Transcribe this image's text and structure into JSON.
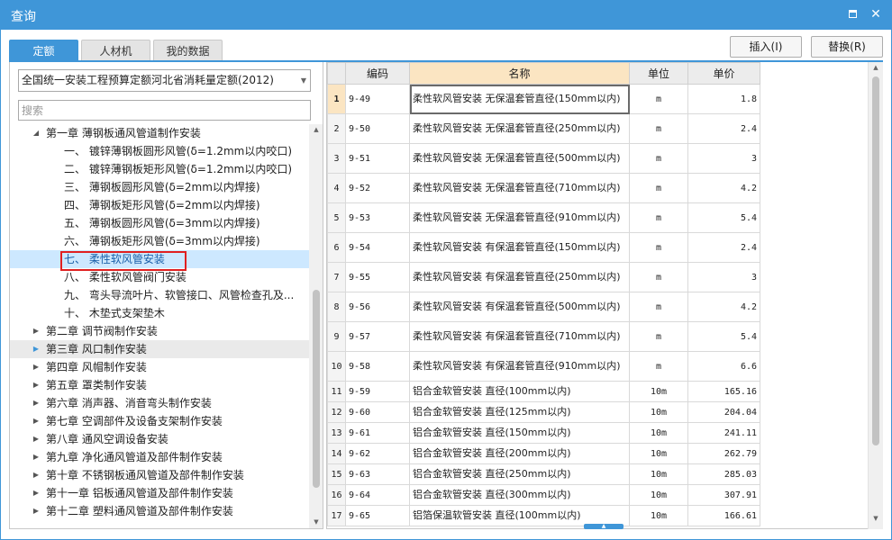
{
  "window": {
    "title": "查询"
  },
  "tabs": [
    {
      "label": "定额",
      "active": true
    },
    {
      "label": "人材机",
      "active": false
    },
    {
      "label": "我的数据",
      "active": false
    }
  ],
  "buttons": {
    "insert": "插入(I)",
    "replace": "替换(R)"
  },
  "left": {
    "combo_value": "全国统一安装工程预算定额河北省消耗量定额(2012)",
    "search_placeholder": "搜索",
    "tree": [
      {
        "label": "第一章 薄钢板通风管道制作安装",
        "level": 0,
        "expanded": true
      },
      {
        "label": "一、 镀锌薄钢板圆形风管(δ=1.2mm以内咬口)",
        "level": 1
      },
      {
        "label": "二、 镀锌薄钢板矩形风管(δ=1.2mm以内咬口)",
        "level": 1
      },
      {
        "label": "三、 薄钢板圆形风管(δ=2mm以内焊接)",
        "level": 1
      },
      {
        "label": "四、 薄钢板矩形风管(δ=2mm以内焊接)",
        "level": 1
      },
      {
        "label": "五、 薄钢板圆形风管(δ=3mm以内焊接)",
        "level": 1
      },
      {
        "label": "六、 薄钢板矩形风管(δ=3mm以内焊接)",
        "level": 1
      },
      {
        "label": "七、 柔性软风管安装",
        "level": 1,
        "selected": true
      },
      {
        "label": "八、 柔性软风管阀门安装",
        "level": 1
      },
      {
        "label": "九、 弯头导流叶片、软管接口、风管检查孔及...",
        "level": 1
      },
      {
        "label": "十、 木垫式支架垫木",
        "level": 1
      },
      {
        "label": "第二章 调节阀制作安装",
        "level": 0
      },
      {
        "label": "第三章 风口制作安装",
        "level": 0,
        "hover": true
      },
      {
        "label": "第四章 风帽制作安装",
        "level": 0
      },
      {
        "label": "第五章 罩类制作安装",
        "level": 0
      },
      {
        "label": "第六章 消声器、消音弯头制作安装",
        "level": 0
      },
      {
        "label": "第七章 空调部件及设备支架制作安装",
        "level": 0
      },
      {
        "label": "第八章 通风空调设备安装",
        "level": 0
      },
      {
        "label": "第九章 净化通风管道及部件制作安装",
        "level": 0
      },
      {
        "label": "第十章 不锈钢板通风管道及部件制作安装",
        "level": 0
      },
      {
        "label": "第十一章 铝板通风管道及部件制作安装",
        "level": 0
      },
      {
        "label": "第十二章 塑料通风管道及部件制作安装",
        "level": 0
      }
    ]
  },
  "grid": {
    "headers": {
      "code": "编码",
      "name": "名称",
      "unit": "单位",
      "price": "单价"
    },
    "rows": [
      {
        "n": "1",
        "code": "9-49",
        "name": "柔性软风管安装 无保温套管直径(150mm以内)",
        "unit": "m",
        "price": "1.8"
      },
      {
        "n": "2",
        "code": "9-50",
        "name": "柔性软风管安装 无保温套管直径(250mm以内)",
        "unit": "m",
        "price": "2.4"
      },
      {
        "n": "3",
        "code": "9-51",
        "name": "柔性软风管安装 无保温套管直径(500mm以内)",
        "unit": "m",
        "price": "3"
      },
      {
        "n": "4",
        "code": "9-52",
        "name": "柔性软风管安装 无保温套管直径(710mm以内)",
        "unit": "m",
        "price": "4.2"
      },
      {
        "n": "5",
        "code": "9-53",
        "name": "柔性软风管安装 无保温套管直径(910mm以内)",
        "unit": "m",
        "price": "5.4"
      },
      {
        "n": "6",
        "code": "9-54",
        "name": "柔性软风管安装 有保温套管直径(150mm以内)",
        "unit": "m",
        "price": "2.4"
      },
      {
        "n": "7",
        "code": "9-55",
        "name": "柔性软风管安装 有保温套管直径(250mm以内)",
        "unit": "m",
        "price": "3"
      },
      {
        "n": "8",
        "code": "9-56",
        "name": "柔性软风管安装 有保温套管直径(500mm以内)",
        "unit": "m",
        "price": "4.2"
      },
      {
        "n": "9",
        "code": "9-57",
        "name": "柔性软风管安装 有保温套管直径(710mm以内)",
        "unit": "m",
        "price": "5.4"
      },
      {
        "n": "10",
        "code": "9-58",
        "name": "柔性软风管安装 有保温套管直径(910mm以内)",
        "unit": "m",
        "price": "6.6"
      },
      {
        "n": "11",
        "code": "9-59",
        "name": "铝合金软管安装 直径(100mm以内)",
        "unit": "10m",
        "price": "165.16"
      },
      {
        "n": "12",
        "code": "9-60",
        "name": "铝合金软管安装 直径(125mm以内)",
        "unit": "10m",
        "price": "204.04"
      },
      {
        "n": "13",
        "code": "9-61",
        "name": "铝合金软管安装 直径(150mm以内)",
        "unit": "10m",
        "price": "241.11"
      },
      {
        "n": "14",
        "code": "9-62",
        "name": "铝合金软管安装 直径(200mm以内)",
        "unit": "10m",
        "price": "262.79"
      },
      {
        "n": "15",
        "code": "9-63",
        "name": "铝合金软管安装 直径(250mm以内)",
        "unit": "10m",
        "price": "285.03"
      },
      {
        "n": "16",
        "code": "9-64",
        "name": "铝合金软管安装 直径(300mm以内)",
        "unit": "10m",
        "price": "307.91"
      },
      {
        "n": "17",
        "code": "9-65",
        "name": "铝箔保温软管安装 直径(100mm以内)",
        "unit": "10m",
        "price": "166.61"
      }
    ]
  }
}
